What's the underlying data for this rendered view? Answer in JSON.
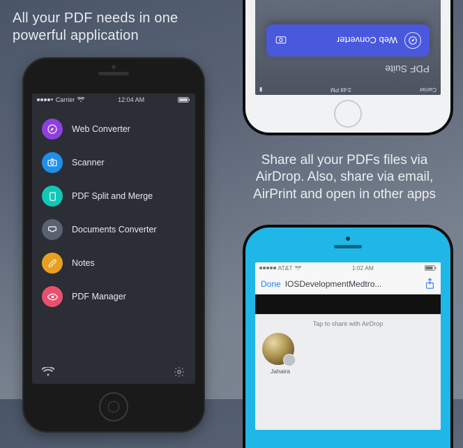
{
  "left": {
    "tagline": "All your PDF needs in one powerful application",
    "statusbar": {
      "carrier": "Carrier",
      "time": "12:04 AM",
      "battery_icon": "battery-icon"
    },
    "menu": [
      {
        "label": "Web Converter",
        "color": "#8f3fe0",
        "icon": "compass-icon"
      },
      {
        "label": "Scanner",
        "color": "#1f8fe8",
        "icon": "camera-icon"
      },
      {
        "label": "PDF Split and Merge",
        "color": "#12c7b6",
        "icon": "file-icon"
      },
      {
        "label": "Documents Converter",
        "color": "#5a6170",
        "icon": "inbox-icon"
      },
      {
        "label": "Notes",
        "color": "#e9a020",
        "icon": "pencil-icon"
      },
      {
        "label": "PDF Manager",
        "color": "#e85070",
        "icon": "eye-icon"
      }
    ],
    "footer": {
      "left_icon": "wifi-icon",
      "right_icon": "gear-icon"
    }
  },
  "right_top": {
    "statusbar": {
      "carrier": "Carrier",
      "time": "3:48 PM"
    },
    "title": "PDF Suite",
    "card": {
      "icon": "compass-icon",
      "label": "Web Converter",
      "trailing_icon": "camera-icon"
    }
  },
  "right_text": "Share all your PDFs files via AirDrop. Also, share via email, AirPrint and open in other apps",
  "right_bottom": {
    "statusbar": {
      "carrier": "AT&T",
      "time": "1:02 AM"
    },
    "navbar": {
      "done": "Done",
      "title": "IOSDevelopmentMedtro...",
      "share_icon": "share-icon"
    },
    "sheet": {
      "hint": "Tap to share with AirDrop",
      "contact_name": "Jahaira"
    }
  }
}
